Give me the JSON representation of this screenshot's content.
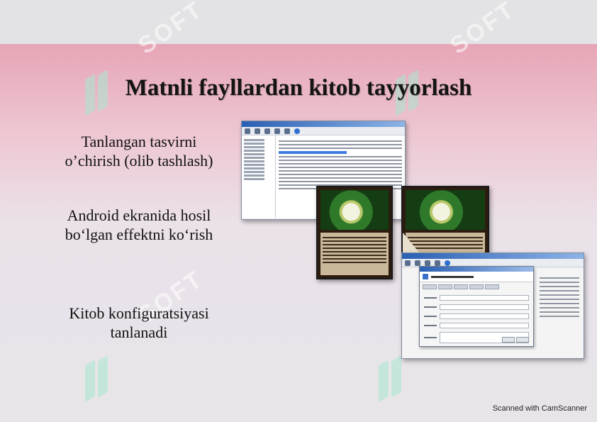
{
  "slide": {
    "title": "Matnli fayllardan kitob tayyorlash",
    "captions": [
      {
        "line1": "Tanlangan tasvirni",
        "line2": "o’chirish (olib tashlash)"
      },
      {
        "line1": "Android ekranida hosil",
        "line2": "bo‘lgan effektni ko‘rish"
      },
      {
        "line1": "Kitob konfiguratsiyasi",
        "line2": "tanlanadi"
      }
    ]
  },
  "watermark": {
    "text": "SOFT",
    "color": "#a8e8d0"
  },
  "scanner_note": "Scanned with CamScanner",
  "colors": {
    "slide_top": "#e7a5b6",
    "slide_bottom": "#e7e4ea",
    "title_text": "#141414",
    "window_titlebar": "#2a5fb3"
  },
  "screenshots": [
    {
      "kind": "editor-window",
      "icon": "window-icon"
    },
    {
      "kind": "book-page",
      "icon": "flower-image"
    },
    {
      "kind": "book-page-curl",
      "icon": "flower-image"
    },
    {
      "kind": "config-dialog",
      "icon": "dialog-icon"
    }
  ]
}
